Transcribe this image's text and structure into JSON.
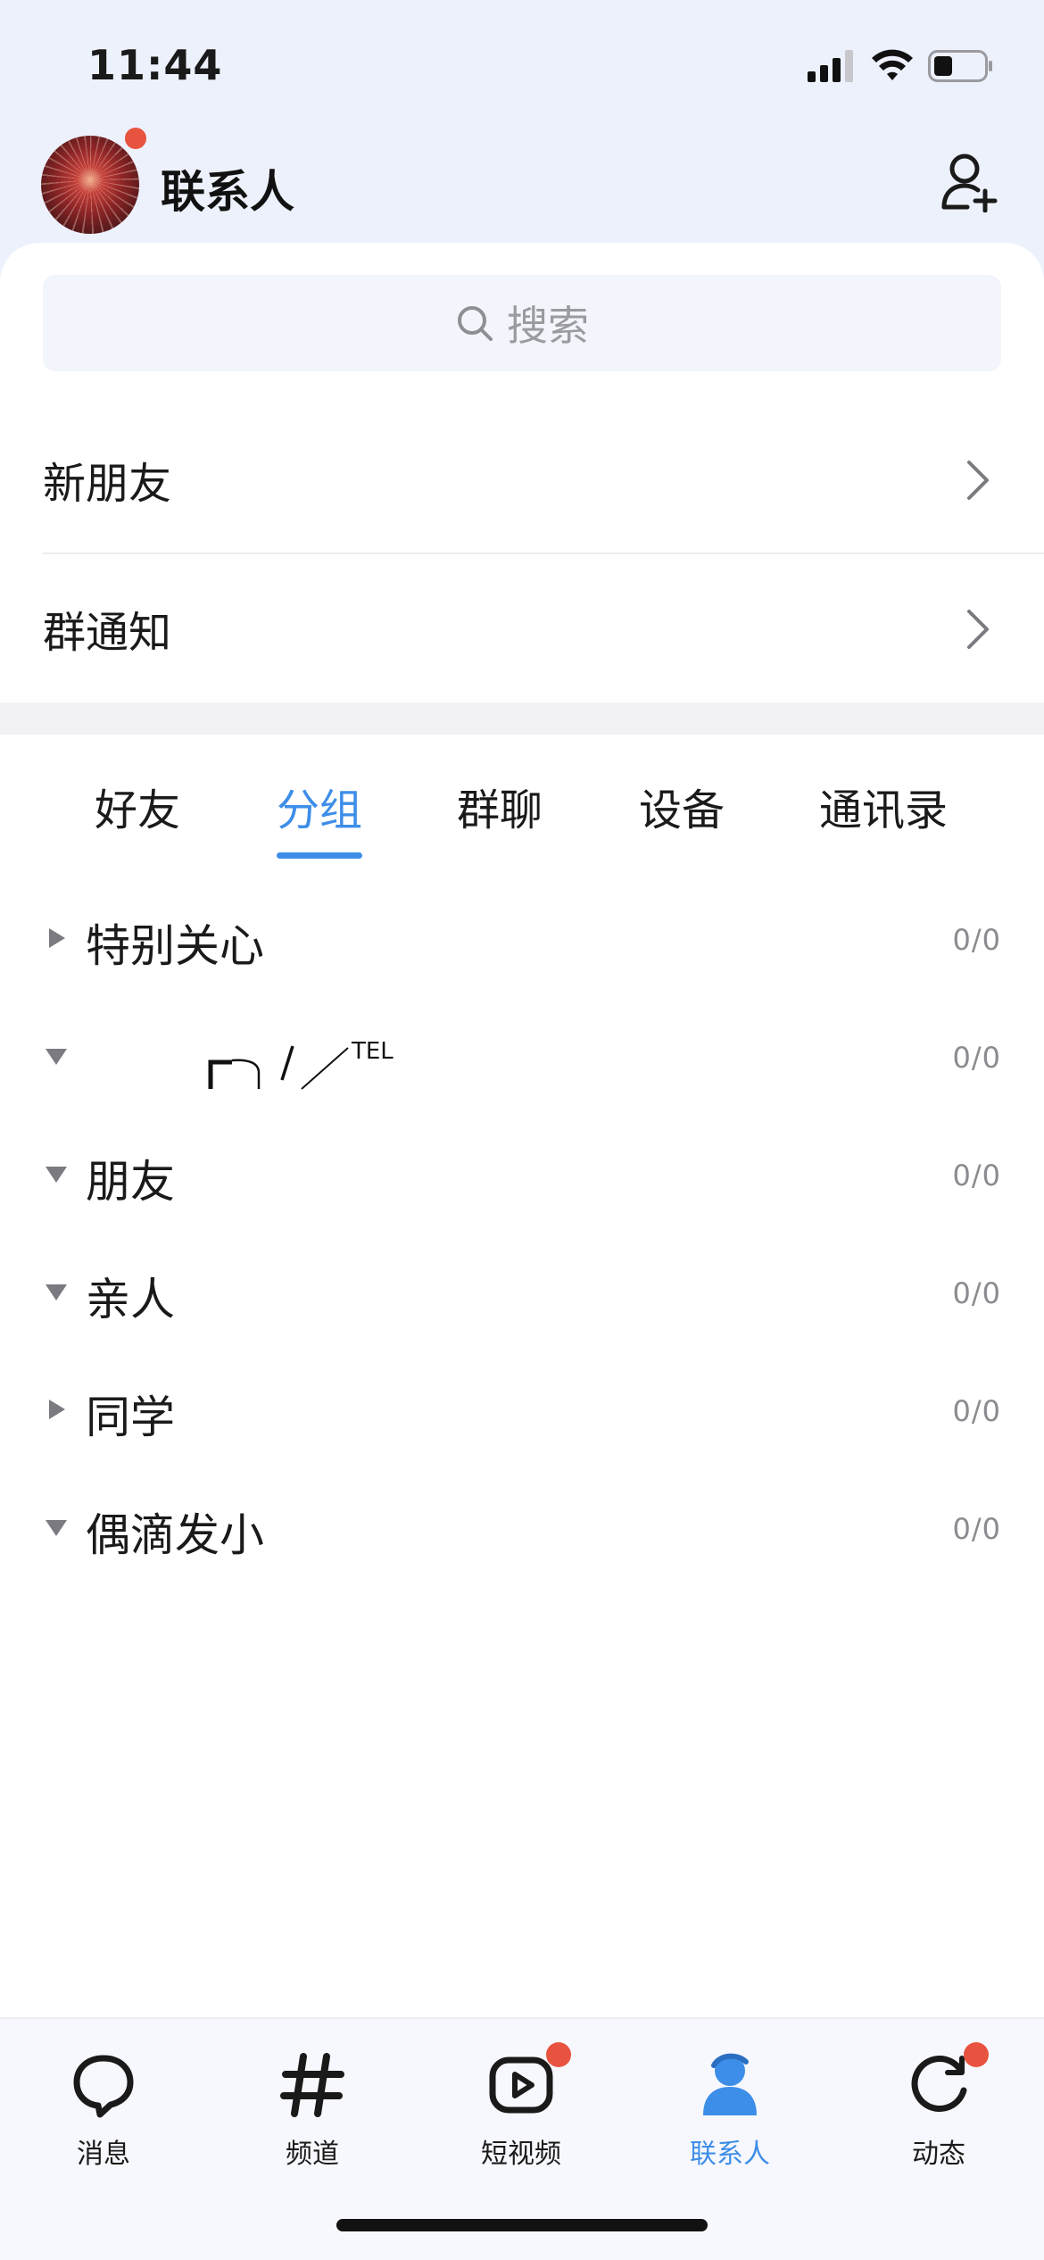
{
  "status_bar": {
    "time": "11:44"
  },
  "header": {
    "title": "联系人",
    "avatar_badge": true
  },
  "search": {
    "placeholder": "搜索"
  },
  "entries": [
    {
      "label": "新朋友"
    },
    {
      "label": "群通知"
    }
  ],
  "tabs": [
    {
      "label": "好友",
      "active": false
    },
    {
      "label": "分组",
      "active": true
    },
    {
      "label": "群聊",
      "active": false
    },
    {
      "label": "设备",
      "active": false
    },
    {
      "label": "通讯录",
      "active": false
    }
  ],
  "groups": [
    {
      "name": "特别关心",
      "count": "0/0",
      "expanded": false
    },
    {
      "name": "",
      "glyph_text": "TEL",
      "count": "0/0",
      "expanded": true
    },
    {
      "name": "朋友",
      "count": "0/0",
      "expanded": true
    },
    {
      "name": "亲人",
      "count": "0/0",
      "expanded": true
    },
    {
      "name": "同学",
      "count": "0/0",
      "expanded": false
    },
    {
      "name": "偶滴发小",
      "count": "0/0",
      "expanded": true
    }
  ],
  "bottom_nav": [
    {
      "label": "消息",
      "icon": "chat-bubble-icon",
      "active": false,
      "badge": false
    },
    {
      "label": "频道",
      "icon": "hash-icon",
      "active": false,
      "badge": false
    },
    {
      "label": "短视频",
      "icon": "video-play-icon",
      "active": false,
      "badge": true
    },
    {
      "label": "联系人",
      "icon": "person-icon",
      "active": true,
      "badge": false
    },
    {
      "label": "动态",
      "icon": "refresh-star-icon",
      "active": false,
      "badge": true
    }
  ],
  "colors": {
    "accent": "#3d8ee8",
    "badge": "#e8533f",
    "header_bg": "#edf1fc"
  }
}
